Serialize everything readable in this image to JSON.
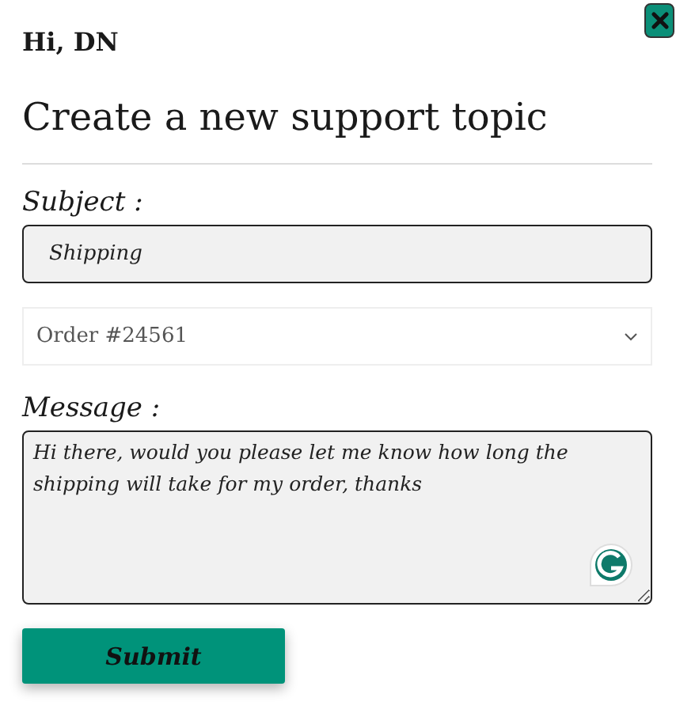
{
  "greeting": "Hi, DN",
  "title": "Create a new support topic",
  "subject": {
    "label": "Subject :",
    "value": "Shipping"
  },
  "order_select": {
    "value": "Order #24561"
  },
  "message": {
    "label": "Message :",
    "value": "Hi there, would you please let me know how long the shipping will take for my order, thanks"
  },
  "submit": "Submit"
}
